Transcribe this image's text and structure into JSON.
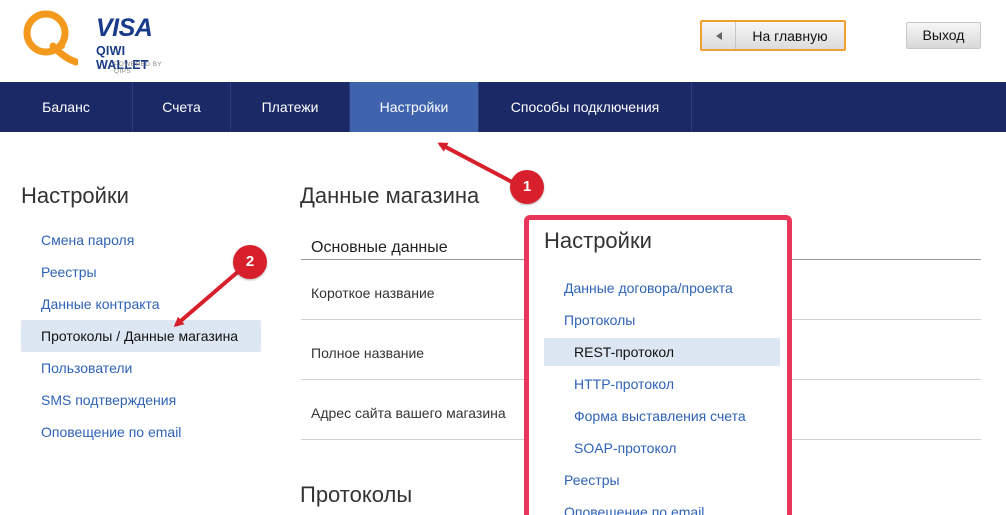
{
  "brand": {
    "visa": "VISA",
    "wallet": "QIWI WALLET",
    "powered": "POWERED BY QIPS"
  },
  "header": {
    "home_button": "На главную",
    "exit_button": "Выход"
  },
  "nav": {
    "items": [
      {
        "label": "Баланс"
      },
      {
        "label": "Счета"
      },
      {
        "label": "Платежи"
      },
      {
        "label": "Настройки"
      },
      {
        "label": "Способы подключения"
      }
    ],
    "active": "Настройки"
  },
  "sidebar": {
    "title": "Настройки",
    "items": [
      {
        "label": "Смена пароля"
      },
      {
        "label": "Реестры"
      },
      {
        "label": "Данные контракта"
      },
      {
        "label": "Протоколы / Данные магазина"
      },
      {
        "label": "Пользователи"
      },
      {
        "label": "SMS подтверждения"
      },
      {
        "label": "Оповещение по email"
      }
    ],
    "active": "Протоколы / Данные магазина"
  },
  "main": {
    "title": "Данные магазина",
    "section_heading": "Основные данные",
    "fields": [
      {
        "label": "Короткое название"
      },
      {
        "label": "Полное название"
      },
      {
        "label": "Адрес сайта вашего магазина"
      }
    ],
    "section2_title": "Протоколы"
  },
  "dropdown": {
    "title": "Настройки",
    "items": [
      {
        "label": "Данные договора/проекта"
      },
      {
        "label": "Протоколы"
      },
      {
        "label": "REST-протокол"
      },
      {
        "label": "HTTP-протокол"
      },
      {
        "label": "Форма выставления счета"
      },
      {
        "label": "SOAP-протокол"
      },
      {
        "label": "Реестры"
      },
      {
        "label": "Оповещение по email"
      }
    ],
    "active": "REST-протокол"
  },
  "annotations": {
    "badge1": "1",
    "badge2": "2"
  },
  "colors": {
    "nav_bg": "#1b2a66",
    "nav_active": "#3f63ad",
    "link": "#2e63b8",
    "highlight": "#dde6f3",
    "overlay_border": "#e8375a",
    "badge": "#d8202d",
    "home_border": "#f0a030"
  }
}
